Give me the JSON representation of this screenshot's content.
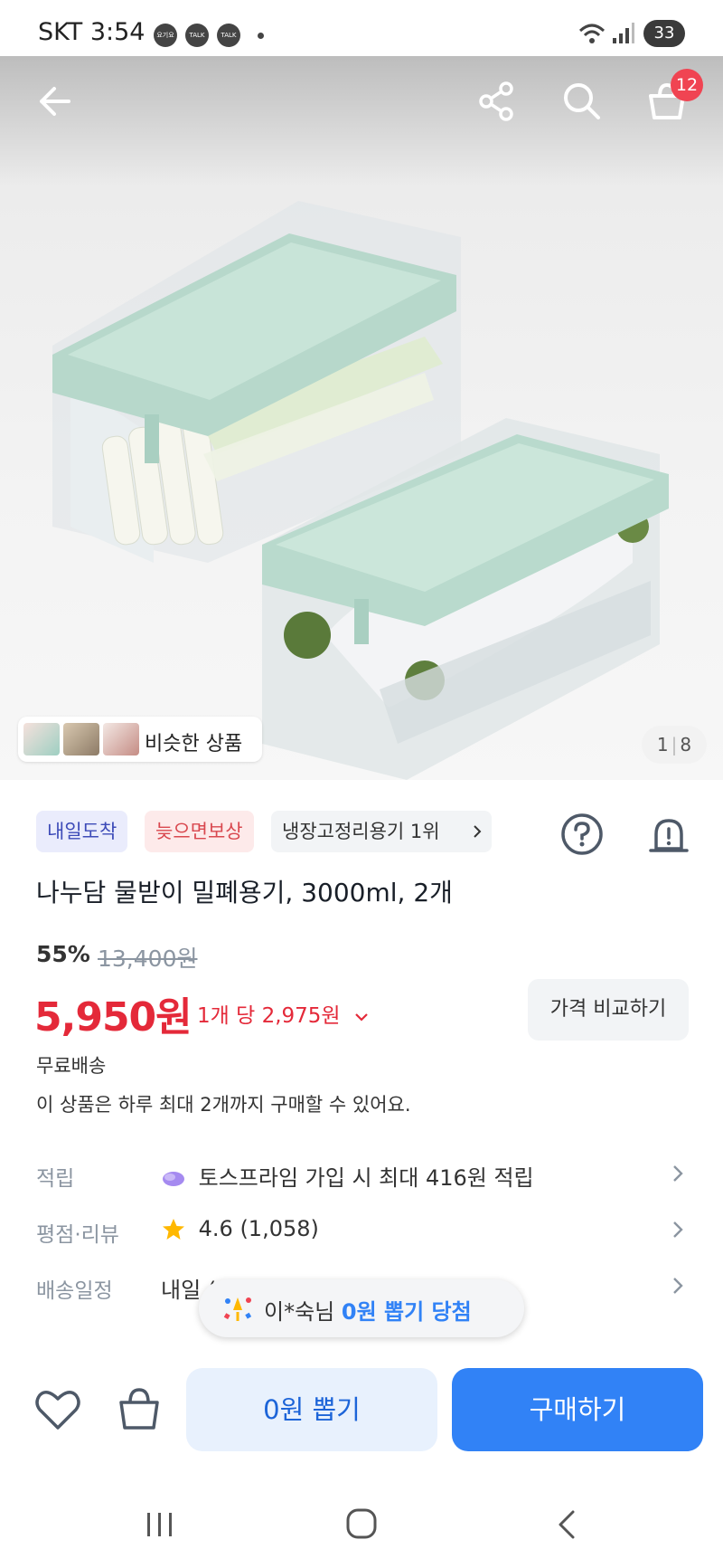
{
  "status_bar": {
    "carrier_time": "SKT 3:54",
    "notifications": [
      "요기요",
      "TALK",
      "TALK"
    ],
    "battery": "33"
  },
  "top_bar": {
    "cart_count": "12"
  },
  "gallery": {
    "similar_label": "비슷한 상품",
    "page_current": "1",
    "page_total": "8"
  },
  "tags": [
    "내일도착",
    "늦으면보상",
    "냉장고정리용기 1위"
  ],
  "tag_colors": {
    "blue_bg": "#eaecfc",
    "blue_fg": "#3d4bb8",
    "red_bg": "#fdeaea",
    "red_fg": "#d9484f",
    "gray_bg": "#f2f4f6"
  },
  "product": {
    "title": "나누담 물받이 밀폐용기, 3000ml, 2개",
    "discount": "55%",
    "original_price": "13,400원",
    "price": "5,950원",
    "unit_price": "1개 당 2,975원",
    "compare_label": "가격 비교하기",
    "shipping": "무료배송",
    "purchase_limit": "이 상품은 하루 최대 2개까지 구매할 수 있어요."
  },
  "info_rows": [
    {
      "label": "적립",
      "value": "토스프라임 가입 시 최대 416원 적립"
    },
    {
      "label": "평점·리뷰",
      "value": "4.6 (1,058)"
    },
    {
      "label": "배송일정",
      "value": "내일 (수) 도착"
    }
  ],
  "toast": {
    "prefix": "이*숙님 ",
    "highlight": "0원 뽑기 당첨"
  },
  "bottom_bar": {
    "zero_draw_label": "0원 뽑기",
    "buy_label": "구매하기"
  },
  "colors": {
    "accent": "#3182f6",
    "price_red": "#e42939",
    "muted": "#8b95a1"
  }
}
